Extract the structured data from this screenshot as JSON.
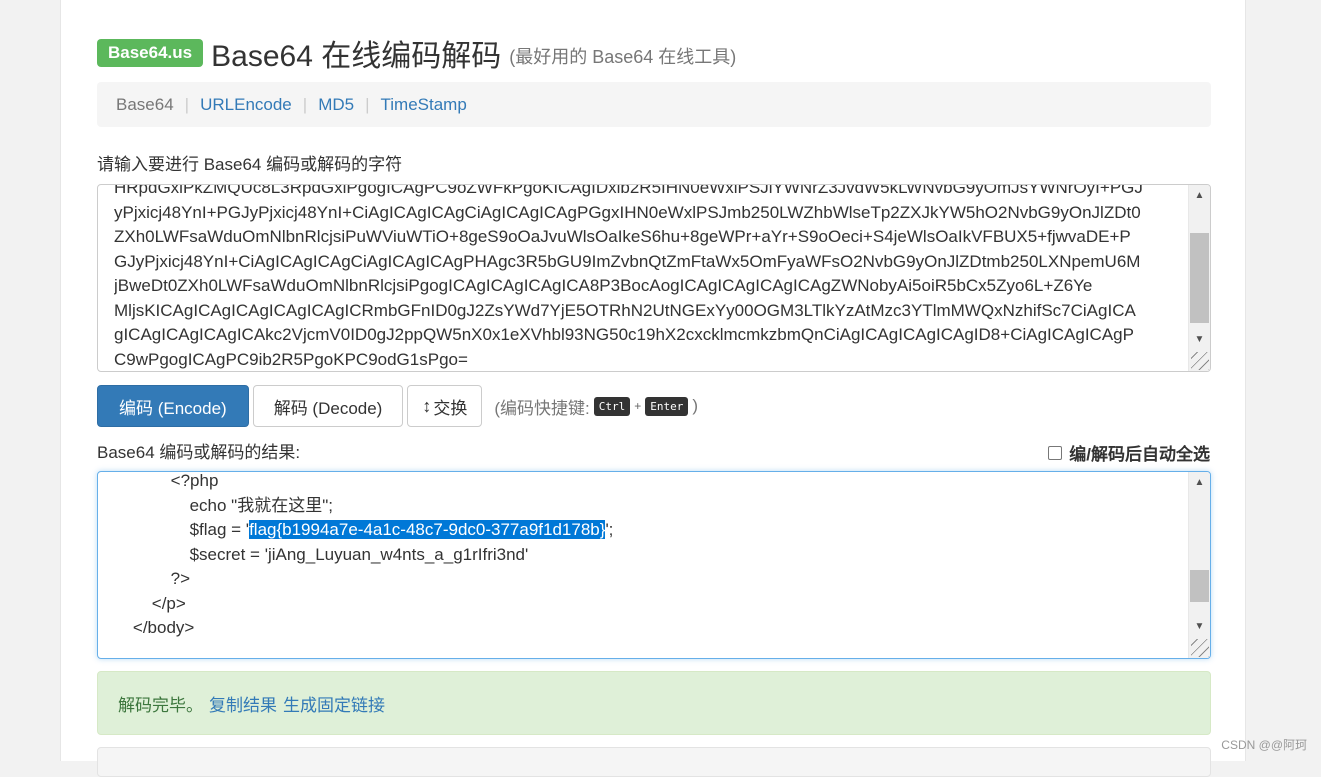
{
  "header": {
    "badge": "Base64.us",
    "title": "Base64 在线编码解码",
    "subtitle": "(最好用的 Base64 在线工具)"
  },
  "nav": {
    "items": [
      "Base64",
      "URLEncode",
      "MD5",
      "TimeStamp"
    ],
    "separator": "|"
  },
  "input": {
    "label": "请输入要进行 Base64 编码或解码的字符",
    "lines": [
      "HRpdGxlPkZMQUc8L3RpdGxlPgogICAgPC9oZWFkPgoKICAgIDxib2R5IHN0eWxlPSJiYWNrZ3JvdW5kLWNvbG9yOmJsYWNrOyI+PGJ",
      "yPjxicj48YnI+PGJyPjxicj48YnI+CiAgICAgICAgCiAgICAgICAgPGgxIHN0eWxlPSJmb250LWZhbWlseTp2ZXJkYW5hO2NvbG9yOnJlZDt0",
      "ZXh0LWFsaWduOmNlbnRlcjsiPuWViuWTiO+8geS9oOaJvuWlsOaIkeS6hu+8geWPr+aYr+S9oOeci+S4jeWlsOaIkVFBUX5+fjwvaDE+P",
      "GJyPjxicj48YnI+CiAgICAgICAgCiAgICAgICAgPHAgc3R5bGU9ImZvbnQtZmFtaWx5OmFyaWFsO2NvbG9yOnJlZDtmb250LXNpemU6M",
      "jBweDt0ZXh0LWFsaWduOmNlbnRlcjsiPgogICAgICAgICAgICA8P3BocAogICAgICAgICAgICAgZWNobyAi5oiR5bCx5Zyo6L+Z6Ye",
      "MljsKICAgICAgICAgICAgICAgICRmbGFnID0gJ2ZsYWd7YjE5OTRhN2UtNGExYy00OGM3LTlkYzAtMzc3YTlmMWQxNzhifSc7CiAgICA",
      "gICAgICAgICAgICAkc2VjcmV0ID0gJ2ppQW5nX0x1eXVhbl93NG50c19hX2cxcklmcmkzbmQnCiAgICAgICAgICAgID8+CiAgICAgICAgP",
      "C9wPgogICAgPC9ib2R5PgoKPC9odG1sPgo="
    ]
  },
  "buttons": {
    "encode": "编码 (Encode)",
    "decode": "解码 (Decode)",
    "swap_arrow": "↕",
    "swap": "交换"
  },
  "shortcut": {
    "prefix": "(编码快捷键:",
    "key1": "Ctrl",
    "plus": "+",
    "key2": "Enter",
    "suffix": ")"
  },
  "output": {
    "label": "Base64 编码或解码的结果:",
    "autoselect": "编/解码后自动全选",
    "line1": "            <?php",
    "line2": "                echo \"我就在这里\";",
    "line3_pre": "                $flag = '",
    "line3_hl": "flag{b1994a7e-4a1c-48c7-9dc0-377a9f1d178b}",
    "line3_post": "';",
    "line4": "                $secret = 'jiAng_Luyuan_w4nts_a_g1rIfri3nd'",
    "line5": "            ?>",
    "line6": "        </p>",
    "line7": "    </body>"
  },
  "result": {
    "status": "解码完毕。",
    "copy": "复制结果",
    "permalink": "生成固定链接"
  },
  "watermark": "CSDN @@阿珂"
}
